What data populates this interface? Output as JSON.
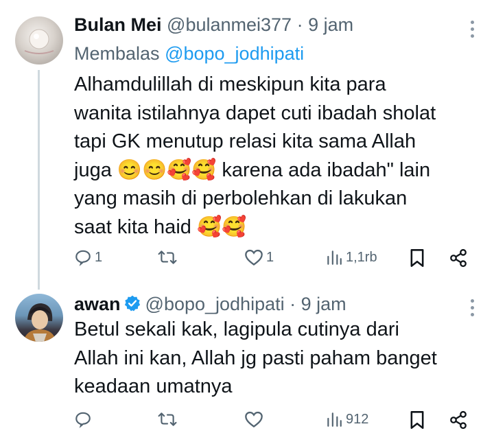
{
  "tweets": [
    {
      "name": "Bulan Mei",
      "handle": "@bulanmei377",
      "dot": "·",
      "time": "9 jam",
      "reply_prefix": "Membalas",
      "reply_handle": "@bopo_jodhipati",
      "text": "Alhamdulillah di meskipun kita para\nwanita istilahnya dapet cuti ibadah sholat\ntapi GK menutup relasi kita sama Allah\njuga 😊😊🥰🥰 karena ada ibadah\" lain\nyang masih di perbolehkan di lakukan\nsaat kita haid 🥰🥰",
      "replies": "1",
      "reposts": "",
      "likes": "1",
      "views": "1,1rb"
    },
    {
      "name": "awan",
      "handle": "@bopo_jodhipati",
      "dot": "·",
      "time": "9 jam",
      "text": "Betul sekali kak, lagipula cutinya dari\nAllah ini kan, Allah jg pasti paham banget\nkeadaan umatnya",
      "replies": "",
      "reposts": "",
      "likes": "",
      "views": "912"
    }
  ],
  "colors": {
    "accent": "#1d9bf0",
    "muted": "#536471",
    "verified": "#1d9bf0"
  }
}
